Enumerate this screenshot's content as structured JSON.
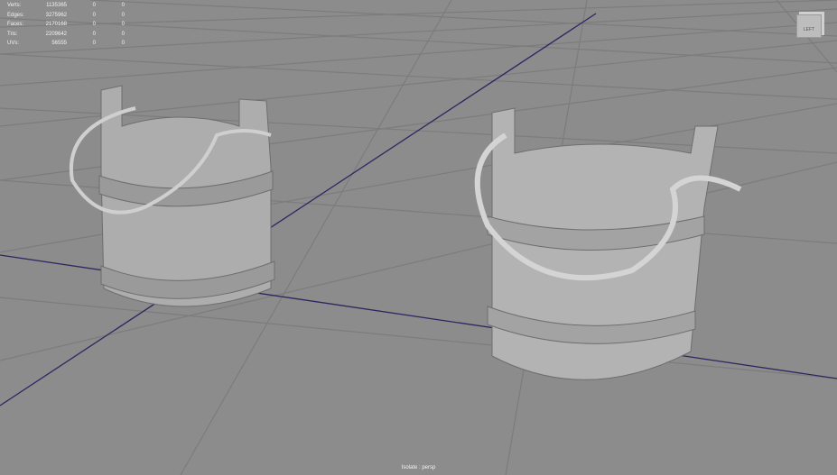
{
  "hud": {
    "rows": [
      {
        "label": "Verts:",
        "value": "1135365",
        "sel": "0",
        "comp": "0"
      },
      {
        "label": "Edges:",
        "value": "3275962",
        "sel": "0",
        "comp": "0"
      },
      {
        "label": "Faces:",
        "value": "2170168",
        "sel": "0",
        "comp": "0"
      },
      {
        "label": "Tris:",
        "value": "2209642",
        "sel": "0",
        "comp": "0"
      },
      {
        "label": "UVs:",
        "value": "56555",
        "sel": "0",
        "comp": "0"
      }
    ]
  },
  "viewcube": {
    "face": "LEFT"
  },
  "camera_label": "Isolate : persp",
  "colors": {
    "background": "#8c8c8c",
    "grid": "#7a7a7a",
    "axis": "#2a1f5a",
    "mesh": "#b8b8b8"
  }
}
